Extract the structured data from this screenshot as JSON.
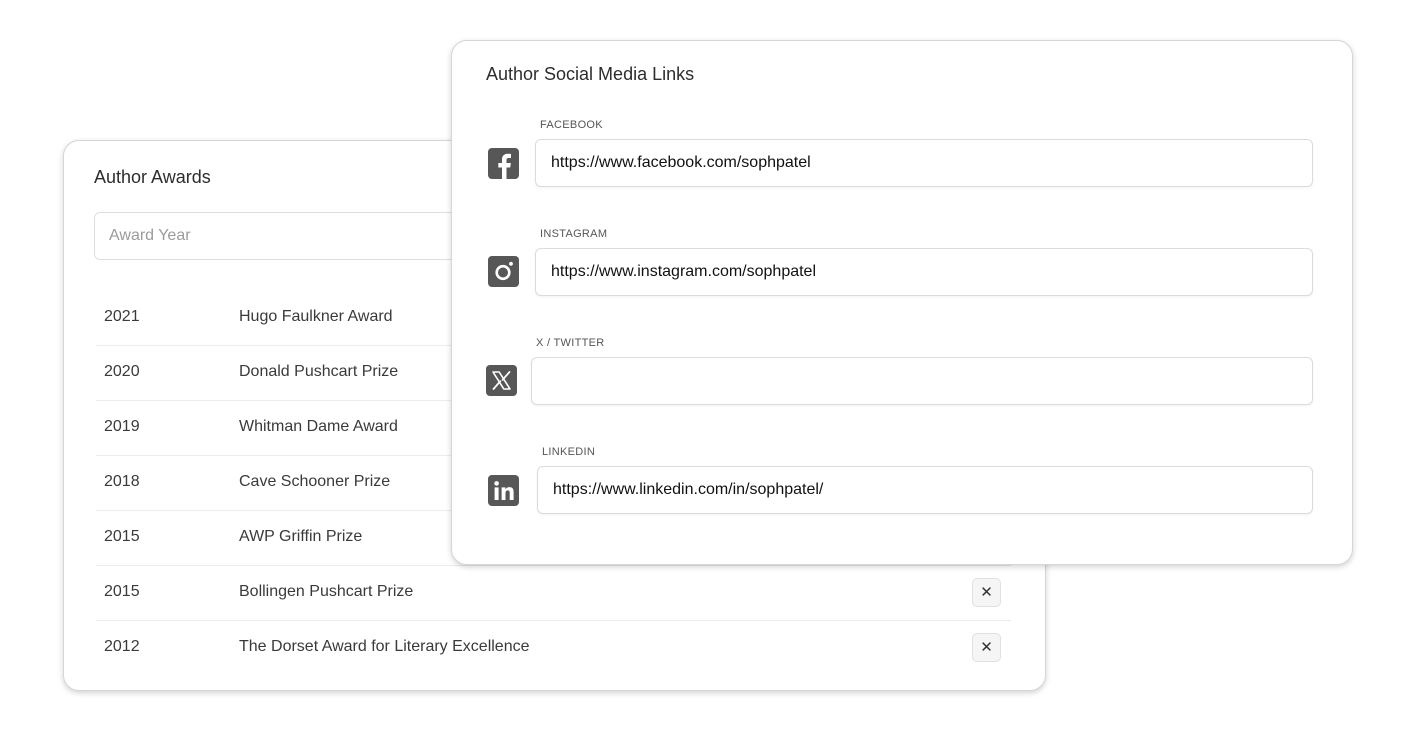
{
  "awards": {
    "title": "Author Awards",
    "year_placeholder": "Award Year",
    "remove_label": "✕",
    "items": [
      {
        "year": "2021",
        "name": "Hugo Faulkner Award"
      },
      {
        "year": "2020",
        "name": "Donald Pushcart Prize"
      },
      {
        "year": "2019",
        "name": "Whitman Dame Award"
      },
      {
        "year": "2018",
        "name": "Cave Schooner Prize"
      },
      {
        "year": "2015",
        "name": "AWP Griffin Prize"
      },
      {
        "year": "2015",
        "name": "Bollingen Pushcart Prize"
      },
      {
        "year": "2012",
        "name": "The Dorset Award for Literary Excellence"
      }
    ]
  },
  "social": {
    "title": "Author Social Media Links",
    "facebook": {
      "label": "FACEBOOK",
      "value": "https://www.facebook.com/sophpatel",
      "icon": "facebook-icon"
    },
    "instagram": {
      "label": "INSTAGRAM",
      "value": "https://www.instagram.com/sophpatel",
      "icon": "instagram-icon"
    },
    "twitter": {
      "label": "X / TWITTER",
      "value": "",
      "icon": "x-twitter-icon"
    },
    "linkedin": {
      "label": "LINKEDIN",
      "value": "https://www.linkedin.com/in/sophpatel/",
      "icon": "linkedin-icon"
    }
  },
  "colors": {
    "icon_bg": "#575757",
    "card_border": "#d6d6d6"
  }
}
